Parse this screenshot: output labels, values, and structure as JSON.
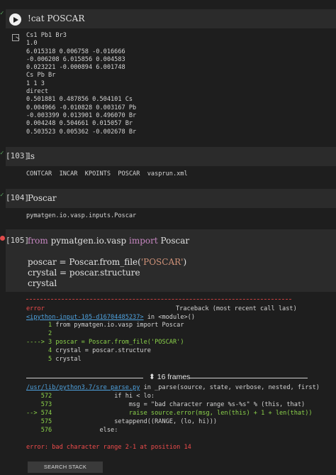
{
  "cell1": {
    "command": "!cat POSCAR",
    "output": [
      "Cs1 Pb1 Br3",
      "1.0",
      "6.015318 0.006758 -0.016666",
      "-0.006208 6.015856 0.004583",
      "0.023221 -0.000894 6.001748",
      "Cs Pb Br",
      "1 1 3",
      "direct",
      "0.501881 0.487856 0.504101 Cs",
      "0.004966 -0.010828 0.003167 Pb",
      "-0.003399 0.013901 0.496070 Br",
      "0.004248 0.504661 0.015057 Br",
      "0.503523 0.005362 -0.002678 Br"
    ]
  },
  "cell2": {
    "count": "[103]",
    "code": "ls",
    "output": "CONTCAR  INCAR  KPOINTS  POSCAR  vasprun.xml"
  },
  "cell3": {
    "count": "[104]",
    "code": "Poscar",
    "output": "pymatgen.io.vasp.inputs.Poscar"
  },
  "cell4": {
    "count": "[105]",
    "line1": {
      "kw1": "from",
      "mod": " pymatgen.io.vasp ",
      "kw2": "import",
      "name": " Poscar"
    },
    "line3": {
      "pre": "poscar = Poscar.from_file(",
      "str": "'POSCAR'",
      "post": ")"
    },
    "line4": "crystal = poscar.structure",
    "line5": "crystal"
  },
  "traceback": {
    "dashes": "-----------------------------------------------------------------------------------",
    "error_label": "error",
    "header": "Traceback (most recent call last)",
    "input_link": "<ipython-input-105-d16704485237>",
    "in_module": " in <module>()",
    "src": [
      {
        "num": "      1 ",
        "code": "from pymatgen.io.vasp import Poscar"
      },
      {
        "num": "      2 ",
        "code": ""
      },
      {
        "num": "----> 3 ",
        "code": "poscar = Poscar.from_file('POSCAR')"
      },
      {
        "num": "      4 ",
        "code": "crystal = poscar.structure"
      },
      {
        "num": "      5 ",
        "code": "crystal"
      }
    ],
    "frames_label": "16 frames",
    "file_link": "/usr/lib/python3.7/sre_parse.py",
    "file_in": " in _parse(source, state, verbose, nested, first)",
    "frames": [
      {
        "num": "    572 ",
        "code": "                if hi < lo:"
      },
      {
        "num": "    573 ",
        "code": "                    msg = \"bad character range %s-%s\" % (this, that)"
      },
      {
        "num": "--> 574 ",
        "code": "                    raise source.error(msg, len(this) + 1 + len(that))"
      },
      {
        "num": "    575 ",
        "code": "                setappend((RANGE, (lo, hi)))"
      },
      {
        "num": "    576 ",
        "code": "            else:"
      }
    ],
    "final_error": "error: bad character range 2-1 at position 14",
    "so_button": "SEARCH STACK OVERFLOW"
  }
}
